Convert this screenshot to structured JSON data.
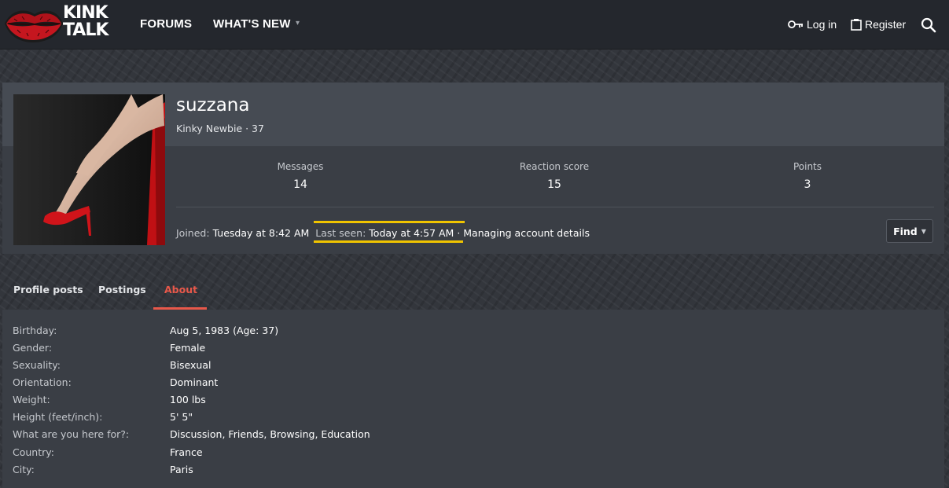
{
  "header": {
    "logo_text_line1": "KINK",
    "logo_text_line2": "TALK",
    "nav": [
      {
        "label": "FORUMS"
      },
      {
        "label": "WHAT'S NEW"
      }
    ],
    "login_label": "Log in",
    "register_label": "Register"
  },
  "profile": {
    "username": "suzzana",
    "user_title": "Kinky Newbie · 37",
    "stats": [
      {
        "label": "Messages",
        "value": "14"
      },
      {
        "label": "Reaction score",
        "value": "15"
      },
      {
        "label": "Points",
        "value": "3"
      }
    ],
    "joined_label": "Joined:",
    "joined_value": "Tuesday at 8:42 AM",
    "last_seen_label": "Last seen:",
    "last_seen_value": "Today at 4:57 AM",
    "activity": "· Managing account details",
    "find_label": "Find",
    "highlight_color": "#f0c400"
  },
  "tabs": [
    {
      "label": "Profile posts"
    },
    {
      "label": "Postings"
    },
    {
      "label": "About",
      "active": true
    }
  ],
  "about": [
    {
      "label": "Birthday:",
      "value": "Aug 5, 1983 (Age: 37)"
    },
    {
      "label": "Gender:",
      "value": "Female"
    },
    {
      "label": "Sexuality:",
      "value": "Bisexual"
    },
    {
      "label": "Orientation:",
      "value": "Dominant"
    },
    {
      "label": "Weight:",
      "value": "100 lbs"
    },
    {
      "label": "Height (feet/inch):",
      "value": "5' 5\""
    },
    {
      "label": "What are you here for?:",
      "value": "Discussion, Friends, Browsing, Education"
    },
    {
      "label": "Country:",
      "value": "France"
    },
    {
      "label": "City:",
      "value": "Paris"
    }
  ],
  "colors": {
    "accent": "#e8584a",
    "header_bg": "#24272d",
    "panel_bg": "#3a3e45"
  }
}
